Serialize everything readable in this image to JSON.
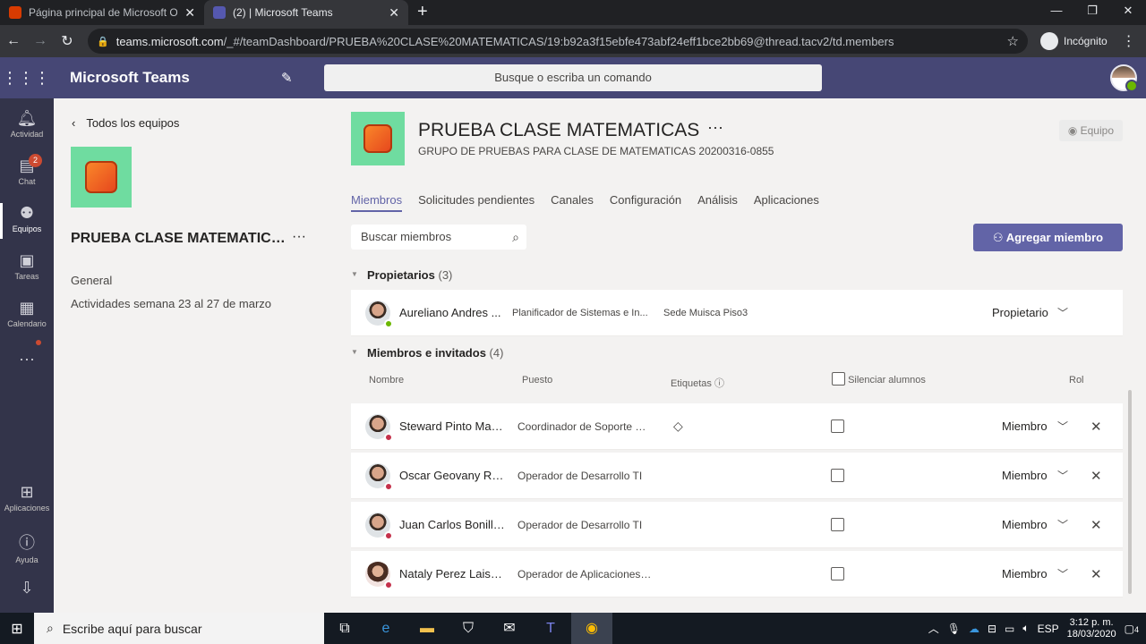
{
  "browser": {
    "tabs": [
      {
        "title": "Página principal de Microsoft Of",
        "close": "✕"
      },
      {
        "title": "(2) | Microsoft Teams",
        "close": "✕"
      }
    ],
    "new_tab": "+",
    "url_host": "teams.microsoft.com",
    "url_path": "/_#/teamDashboard/PRUEBA%20CLASE%20MATEMATICAS/19:b92a3f15ebfe473abf24eff1bce2bb69@thread.tacv2/td.members",
    "incognito_label": "Incógnito"
  },
  "teams": {
    "app_name": "Microsoft Teams",
    "search_placeholder": "Busque o escriba un comando",
    "rail": [
      {
        "label": "Actividad"
      },
      {
        "label": "Chat",
        "badge": "2"
      },
      {
        "label": "Equipos"
      },
      {
        "label": "Tareas"
      },
      {
        "label": "Calendario"
      },
      {
        "label": "···"
      },
      {
        "label": "Aplicaciones"
      },
      {
        "label": "Ayuda"
      }
    ]
  },
  "side": {
    "back_label": "Todos los equipos",
    "team_name": "PRUEBA CLASE MATEMATICAS",
    "more": "···",
    "channels": [
      "General",
      "Actividades semana 23 al 27 de marzo"
    ]
  },
  "main": {
    "team_title": "PRUEBA CLASE MATEMATICAS",
    "more": "···",
    "team_desc": "GRUPO DE PRUEBAS PARA CLASE DE MATEMATICAS 20200316-0855",
    "visibility": "Equipo",
    "tabs": [
      "Miembros",
      "Solicitudes pendientes",
      "Canales",
      "Configuración",
      "Análisis",
      "Aplicaciones"
    ],
    "search_members": "Buscar miembros",
    "add_member": "Agregar miembro",
    "owners_header": "Propietarios",
    "owners_count": "(3)",
    "members_header": "Miembros e invitados",
    "members_count": "(4)",
    "columns": {
      "name": "Nombre",
      "title": "Puesto",
      "tags": "Etiquetas",
      "mute": "Silenciar alumnos",
      "role": "Rol"
    },
    "owners": [
      {
        "name": "Aureliano Andres ...",
        "title": "Planificador de Sistemas e In...",
        "location": "Sede Muisca Piso3",
        "role": "Propietario"
      }
    ],
    "members": [
      {
        "name": "Steward Pinto Mart...",
        "title": "Coordinador de Soporte MIS",
        "role": "Miembro"
      },
      {
        "name": "Oscar Geovany Ric...",
        "title": "Operador de Desarrollo TI",
        "role": "Miembro"
      },
      {
        "name": "Juan Carlos Bonilla...",
        "title": "Operador de Desarrollo TI",
        "role": "Miembro"
      },
      {
        "name": "Nataly Perez Laiseca",
        "title": "Operador de Aplicaciones TI",
        "role": "Miembro"
      }
    ]
  },
  "taskbar": {
    "search_placeholder": "Escribe aquí para buscar",
    "lang": "ESP",
    "time": "3:12 p. m.",
    "date": "18/03/2020",
    "notifications": "4"
  }
}
